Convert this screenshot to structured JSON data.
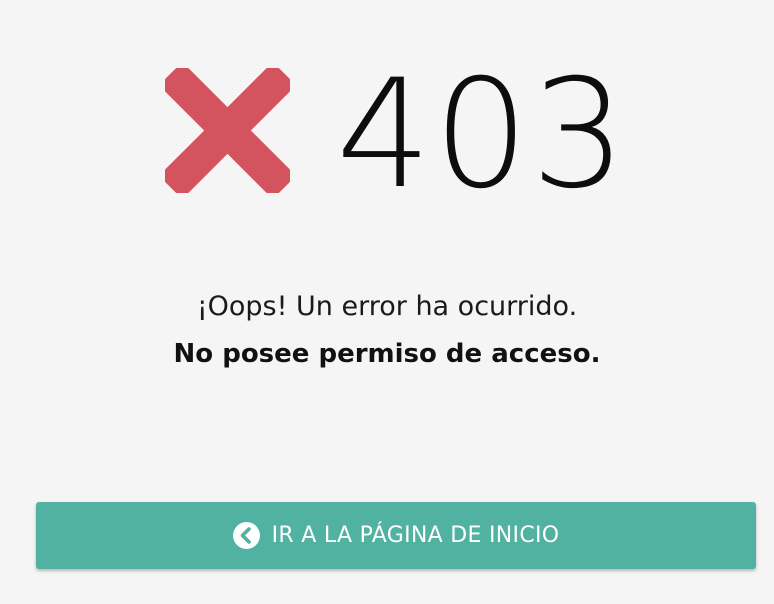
{
  "error": {
    "code": "403",
    "icon": "close-icon",
    "icon_color": "#d3545e"
  },
  "message": {
    "line1": "¡Oops! Un error ha ocurrido.",
    "line2": "No posee permiso de acceso."
  },
  "button": {
    "label": "IR A LA PÁGINA DE INICIO",
    "icon": "chevron-left-circle-icon",
    "background_color": "#52b2a1",
    "text_color": "#ffffff"
  },
  "page": {
    "background_color": "#f5f5f5"
  }
}
